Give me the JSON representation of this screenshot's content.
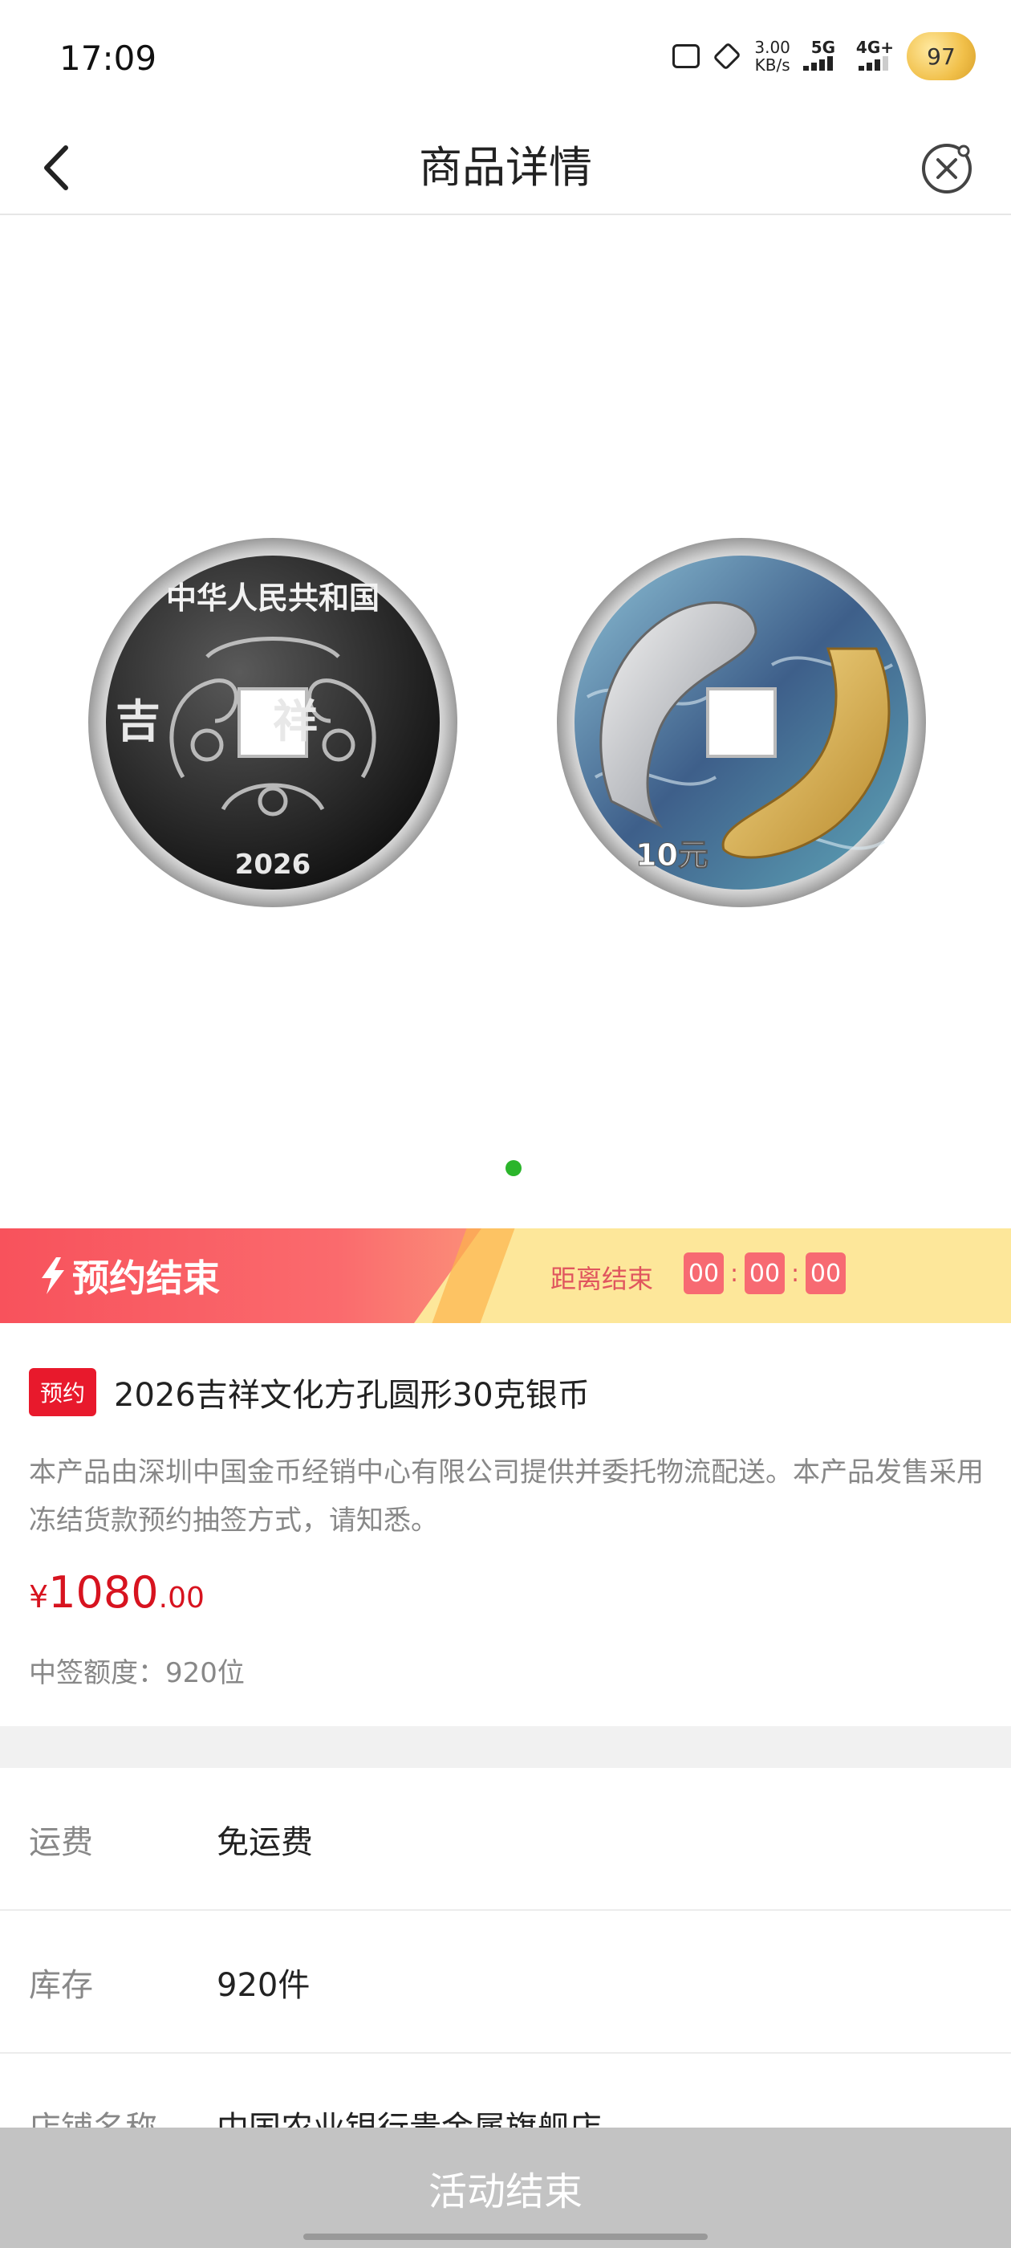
{
  "status_bar": {
    "time": "17:09",
    "speed_value": "3.00",
    "speed_unit": "KB/s",
    "net1": "5G",
    "net2": "4G+",
    "battery": "97"
  },
  "nav": {
    "title": "商品详情"
  },
  "gallery": {
    "coin_left_year": "2026",
    "coin_right_value": "10元",
    "coin_left_text": "中华人民共和国",
    "coin_left_side": "吉祥",
    "pagination_active": 1,
    "pagination_total": 1
  },
  "promo": {
    "title": "预约结束",
    "countdown_label": "距离结束",
    "hours": "00",
    "minutes": "00",
    "seconds": "00",
    "sep": ":"
  },
  "product": {
    "tag": "预约",
    "title": "2026吉祥文化方孔圆形30克银币",
    "description": "本产品由深圳中国金币经销中心有限公司提供并委托物流配送。本产品发售采用冻结货款预约抽签方式，请知悉。",
    "currency": "¥",
    "price_int": "1080",
    "price_dec": ".00",
    "quota": "中签额度：920位"
  },
  "details": [
    {
      "label": "运费",
      "value": "免运费"
    },
    {
      "label": "库存",
      "value": "920件"
    },
    {
      "label": "店铺名称",
      "value": "中国农业银行贵金属旗舰店"
    }
  ],
  "bottom": {
    "button": "活动结束"
  },
  "colors": {
    "accent_red": "#d7131f",
    "promo_red": "#f8525c",
    "promo_yellow": "#fde79a",
    "disabled_gray": "#c3c3c3",
    "dot_green": "#2bb52b"
  }
}
